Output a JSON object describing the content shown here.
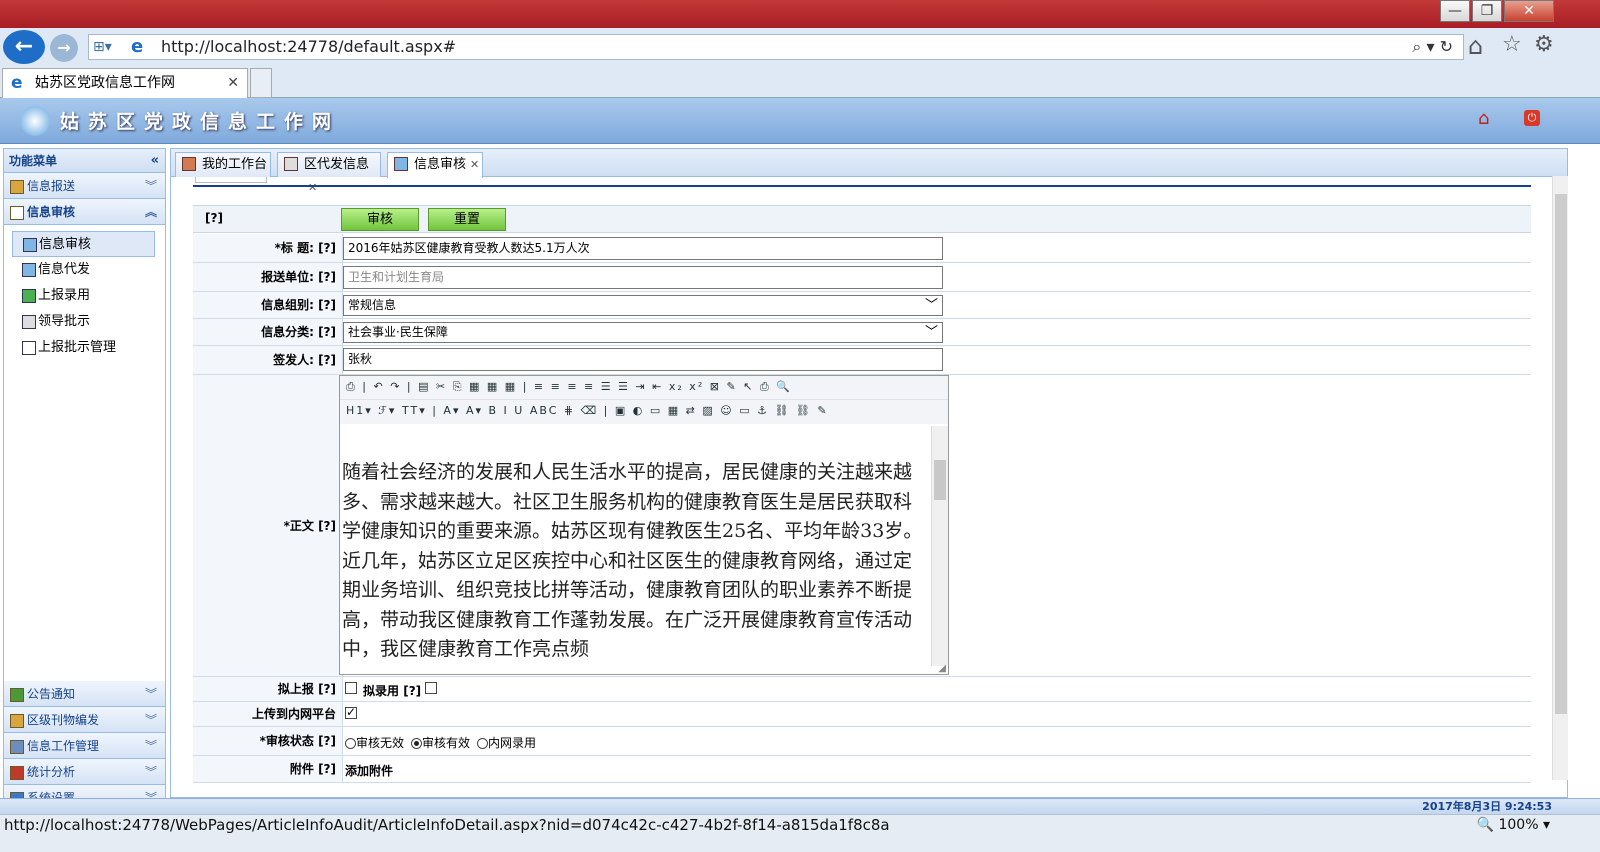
{
  "browser": {
    "url": "http://localhost:24778/default.aspx#",
    "tab_title": "姑苏区党政信息工作网",
    "status_url": "http://localhost:24778/WebPages/ArticleInfoAudit/ArticleInfoDetail.aspx?nid=d074c42c-c427-4b2f-8f14-a815da1f8c8a",
    "zoom": "100%"
  },
  "app": {
    "title": "姑苏区党政信息工作网"
  },
  "sidebar": {
    "header": "功能菜单",
    "sections": [
      {
        "label": "信息报送",
        "expanded": false
      },
      {
        "label": "信息审核",
        "expanded": true
      }
    ],
    "items": [
      {
        "label": "信息审核",
        "active": true
      },
      {
        "label": "信息代发"
      },
      {
        "label": "上报录用"
      },
      {
        "label": "领导批示"
      },
      {
        "label": "上报批示管理"
      }
    ],
    "bottom_sections": [
      {
        "label": "公告通知"
      },
      {
        "label": "区级刊物编发"
      },
      {
        "label": "信息工作管理"
      },
      {
        "label": "统计分析"
      },
      {
        "label": "系统设置"
      }
    ]
  },
  "content_tabs": [
    {
      "label": "我的工作台",
      "closable": false
    },
    {
      "label": "区代发信息",
      "closable": true
    },
    {
      "label": "信息审核",
      "closable": true,
      "active": true
    }
  ],
  "form": {
    "help": "[?]",
    "audit_button": "审核",
    "reset_button": "重置",
    "title_label": "*标 题:",
    "title_value": "2016年姑苏区健康教育受教人数达5.1万人次",
    "unit_label": "报送单位:",
    "unit_placeholder": "卫生和计划生育局",
    "group_label": "信息组别:",
    "group_value": "常规信息",
    "category_label": "信息分类:",
    "category_value": "社会事业·民生保障",
    "signer_label": "签发人:",
    "signer_value": "张秋",
    "body_label": "*正文",
    "body_text": "随着社会经济的发展和人民生活水平的提高，居民健康的关注越来越多、需求越来越大。社区卫生服务机构的健康教育医生是居民获取科学健康知识的重要来源。姑苏区现有健教医生25名、平均年龄33岁。近几年，姑苏区立足区疾控中心和社区医生的健康教育网络，通过定期业务培训、组织竞技比拼等活动，健康教育团队的职业素养不断提高，带动我区健康教育工作蓬勃发展。在广泛开展健康教育宣传活动中，我区健康教育工作亮点频",
    "report_label": "拟上报",
    "record_label": "拟录用",
    "report_checked": false,
    "record_checked": false,
    "upload_label": "上传到内网平台",
    "upload_checked": true,
    "status_label": "*审核状态",
    "status_options": [
      "审核无效",
      "审核有效",
      "内网录用"
    ],
    "status_selected": 1,
    "attach_label": "附件",
    "attach_link": "添加附件"
  },
  "toolbar_row1": "⎙ | ↶ ↷ | ▤ ✂ ⎘ ▦ ▦ ▦ | ≡ ≡ ≡ ≡ ☰ ☰ ⇥ ⇤ x₂ x² ⊠ ✎ ↖ ⎙ 🔍",
  "toolbar_row2": "H1▾ ℱ▾ TT▾ | A▾ A▾ B I U ABC ⋕ ⌫ | ▣ ◐ ▭ ▦ ⇄ ▨ ☺ ▭ ⚓ ⛓ ⛓ ✎",
  "footer_datetime": "2017年8月3日 9:24:53",
  "colors": {
    "accent": "#15428b",
    "header": "#7fa9dc",
    "button_green": "#71c43d"
  }
}
